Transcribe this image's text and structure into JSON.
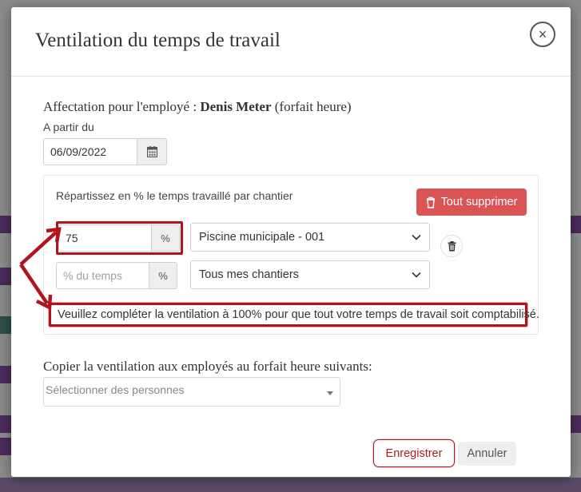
{
  "modal": {
    "title": "Ventilation du temps de travail",
    "close_label": "×"
  },
  "assignment": {
    "prefix": "Affectation pour l'employé : ",
    "employee_name": "Denis Meter",
    "suffix": " (forfait heure)"
  },
  "start_date": {
    "label": "A partir du",
    "value": "06/09/2022"
  },
  "ventilation": {
    "hint": "Répartissez en % le temps travaillé par chantier",
    "delete_all_label": "Tout supprimer",
    "rows": [
      {
        "percent_value": "75",
        "percent_placeholder": "% du temps",
        "unit": "%",
        "site": "Piscine municipale - 001"
      },
      {
        "percent_value": "",
        "percent_placeholder": "% du temps",
        "unit": "%",
        "site": "Tous mes chantiers"
      }
    ],
    "warning": "Veuillez compléter la ventilation à 100% pour que tout votre temps de travail soit comptabilisé."
  },
  "copy": {
    "label": "Copier la ventilation aux employés au forfait heure suivants:",
    "placeholder": "Sélectionner des personnes"
  },
  "footer": {
    "save_label": "Enregistrer",
    "cancel_label": "Annuler"
  },
  "colors": {
    "danger": "#db5454",
    "highlight": "#b0131c",
    "save_text": "#a81d23"
  },
  "icons": {
    "close": "close-icon",
    "calendar": "calendar-icon",
    "trash": "trash-icon",
    "chevron": "chevron-down-icon",
    "arrows": "annotation-arrow"
  }
}
